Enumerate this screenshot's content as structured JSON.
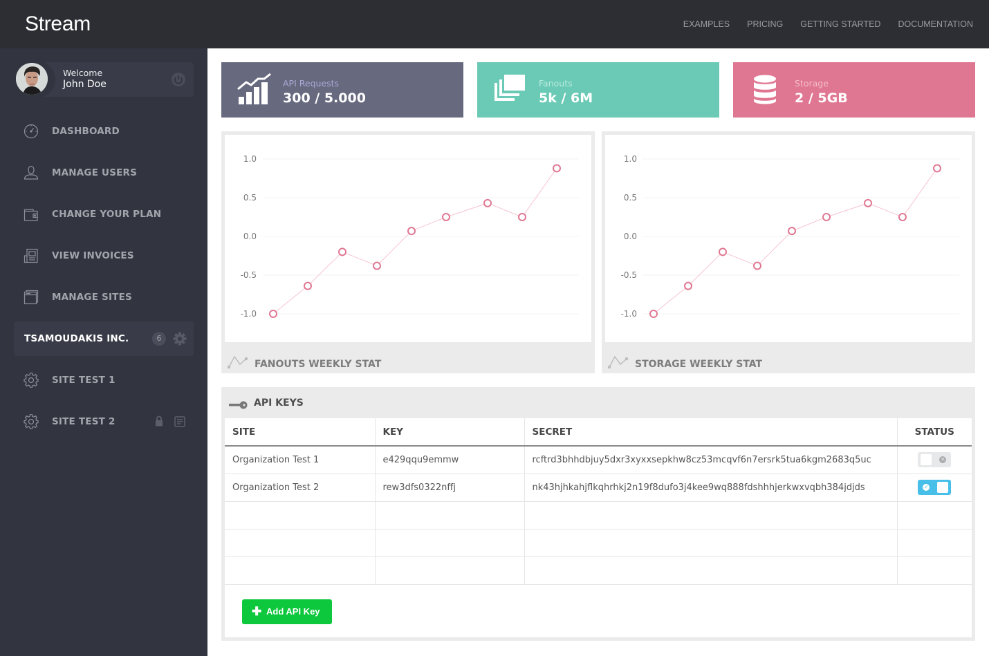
{
  "app": {
    "title": "Stream"
  },
  "topnav": {
    "items": [
      "EXAMPLES",
      "PRICING",
      "GETTING STARTED",
      "DOCUMENTATION"
    ]
  },
  "user": {
    "greeting": "Welcome",
    "name": "John Doe"
  },
  "sidebar": {
    "items": [
      {
        "label": "DASHBOARD",
        "icon": "dashboard-gauge-icon"
      },
      {
        "label": "MANAGE USERS",
        "icon": "user-icon"
      },
      {
        "label": "CHANGE YOUR PLAN",
        "icon": "wallet-icon"
      },
      {
        "label": "VIEW INVOICES",
        "icon": "invoice-icon"
      },
      {
        "label": "MANAGE SITES",
        "icon": "browser-window-icon"
      }
    ],
    "organization": {
      "label": "TSAMOUDAKIS INC.",
      "badge": "6"
    },
    "sites": [
      {
        "label": "SITE TEST 1",
        "icon": "gear-icon"
      },
      {
        "label": "SITE TEST 2",
        "icon": "gear-icon",
        "extra_icons": [
          "lock-icon",
          "document-icon"
        ]
      }
    ]
  },
  "stats": [
    {
      "label": "API Requests",
      "value": "300 / 5.000",
      "color": "#67697f",
      "label_color": "#a8aad6",
      "icon": "growth-chart-icon"
    },
    {
      "label": "Fanouts",
      "value": "5k / 6M",
      "color": "#6bcab5",
      "label_color": "#b7eadf",
      "icon": "stacked-cards-icon"
    },
    {
      "label": "Storage",
      "value": "2 / 5GB",
      "color": "#e07792",
      "label_color": "#f4bccb",
      "icon": "database-icon"
    }
  ],
  "chart_data": [
    {
      "type": "line",
      "title": "FANOUTS WEEKLY STAT",
      "x": [
        1,
        2,
        3,
        4,
        5,
        6,
        7,
        8,
        9
      ],
      "values": [
        -1.0,
        -0.64,
        -0.2,
        -0.38,
        0.07,
        0.25,
        0.43,
        0.25,
        0.88
      ],
      "yticks": [
        "1.0",
        "0.5",
        "0.0",
        "-0.5",
        "-1.0"
      ],
      "ylim": [
        -1.0,
        1.0
      ],
      "xlabel": "",
      "ylabel": "",
      "grid": true,
      "color": "#e07792"
    },
    {
      "type": "line",
      "title": "STORAGE WEEKLY STAT",
      "x": [
        1,
        2,
        3,
        4,
        5,
        6,
        7,
        8,
        9
      ],
      "values": [
        -1.0,
        -0.64,
        -0.2,
        -0.38,
        0.07,
        0.25,
        0.43,
        0.25,
        0.88
      ],
      "yticks": [
        "1.0",
        "0.5",
        "0.0",
        "-0.5",
        "-1.0"
      ],
      "ylim": [
        -1.0,
        1.0
      ],
      "xlabel": "",
      "ylabel": "",
      "grid": true,
      "color": "#e07792"
    }
  ],
  "api_keys": {
    "title": "API KEYS",
    "columns": [
      "SITE",
      "KEY",
      "SECRET",
      "STATUS"
    ],
    "rows": [
      {
        "site": "Organization Test 1",
        "key": "e429qqu9emmw",
        "secret": "rcftrd3bhhdbjuy5dxr3xyxxsepkhw8cz53mcqvf6n7ersrk5tua6kgm2683q5uc",
        "status": "off"
      },
      {
        "site": "Organization Test 2",
        "key": "rew3dfs0322nffj",
        "secret": "nk43hjhkahjflkqhrhkj2n19f8dufo3j4kee9wq888fdshhhjerkwxvqbh384jdjds",
        "status": "on"
      }
    ],
    "empty_rows": 3,
    "add_button": "Add API Key"
  }
}
